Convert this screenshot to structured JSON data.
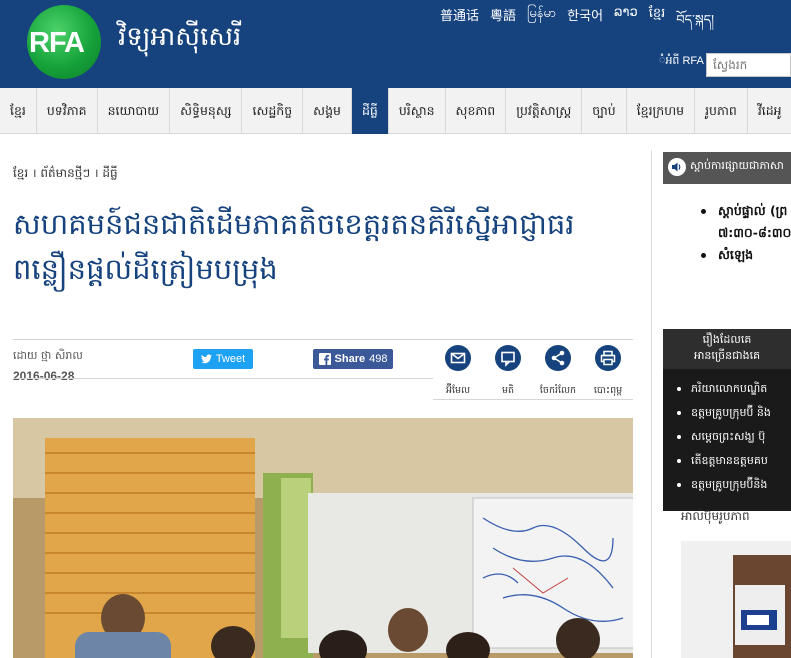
{
  "header": {
    "logo_text": "RFA",
    "site_title": "វិទ្យុអាស៊ីសេរី",
    "languages": [
      "普通话",
      "粵語",
      "မြန်မာ",
      "한국어",
      "ລາວ",
      "ខ្មែរ",
      "བོད་སྐད།"
    ],
    "rfa_label": "ំអំពី RFA",
    "search_placeholder": "ស្វែងរក"
  },
  "nav": {
    "items": [
      "ខ្មែរ",
      "បទវិភាគ",
      "នយោបាយ",
      "សិទ្ធិមនុស្ស",
      "សេដ្ឋកិច្ច",
      "សង្គម",
      "ដីធ្លី",
      "បរិស្ថាន",
      "សុខភាព",
      "ប្រវត្តិសាស្ត្រ",
      "ច្បាប់",
      "ខ្មែរក្រហម",
      "រូបភាព",
      "វីដេអូ"
    ],
    "active_index": 6
  },
  "article": {
    "breadcrumb": "ខ្មែរ । ព័ត៌មានថ្មីៗ । ដីធ្លី",
    "headline": "សហគមន៍ជនជាតិដើមភាគតិចខេត្តរតនគិរីស្នើអាជ្ញាធរពន្លឿនផ្ដល់ដីត្រៀមបម្រុង",
    "byline": "ដោយ ថ្មា សិរាល",
    "date": "2016-06-28",
    "tweet_label": "Tweet",
    "share_label": "Share",
    "share_count": "498",
    "tools": [
      {
        "label": "អ៊ីមែល",
        "icon": "email-icon"
      },
      {
        "label": "មតិ",
        "icon": "comment-icon"
      },
      {
        "label": "ចែករំលែក",
        "icon": "share-icon"
      },
      {
        "label": "បោះពុម្ព",
        "icon": "print-icon"
      }
    ]
  },
  "sidebar": {
    "listen_title": "ស្ដាប់ការផ្សាយជាភាសា",
    "listen_items": [
      "ស្ដាប់ផ្ទាល់ (ព្រ",
      "៧:៣០-៨:៣០",
      "សំឡេង"
    ],
    "popular_heading_1": "រឿងដែលគេ",
    "popular_heading_2": "អានច្រើនជាងគេ",
    "popular_items": [
      "ភរិយាលោកបណ្ឌិត",
      "ឧត្តមគ្រូបក្រុមប៊ី និង",
      "សម្ដេចព្រះសង្ឃ ប៊ុ",
      "តើឧត្តមានឧត្តមគប",
      "ឧត្តមគ្រូបក្រុមប៊ីនិង"
    ],
    "album_label": "អាល់ប៊ុមរូបភាព"
  },
  "colors": {
    "brand_blue": "#16437e",
    "twitter_blue": "#1da1f2",
    "facebook_blue": "#3b5998"
  }
}
